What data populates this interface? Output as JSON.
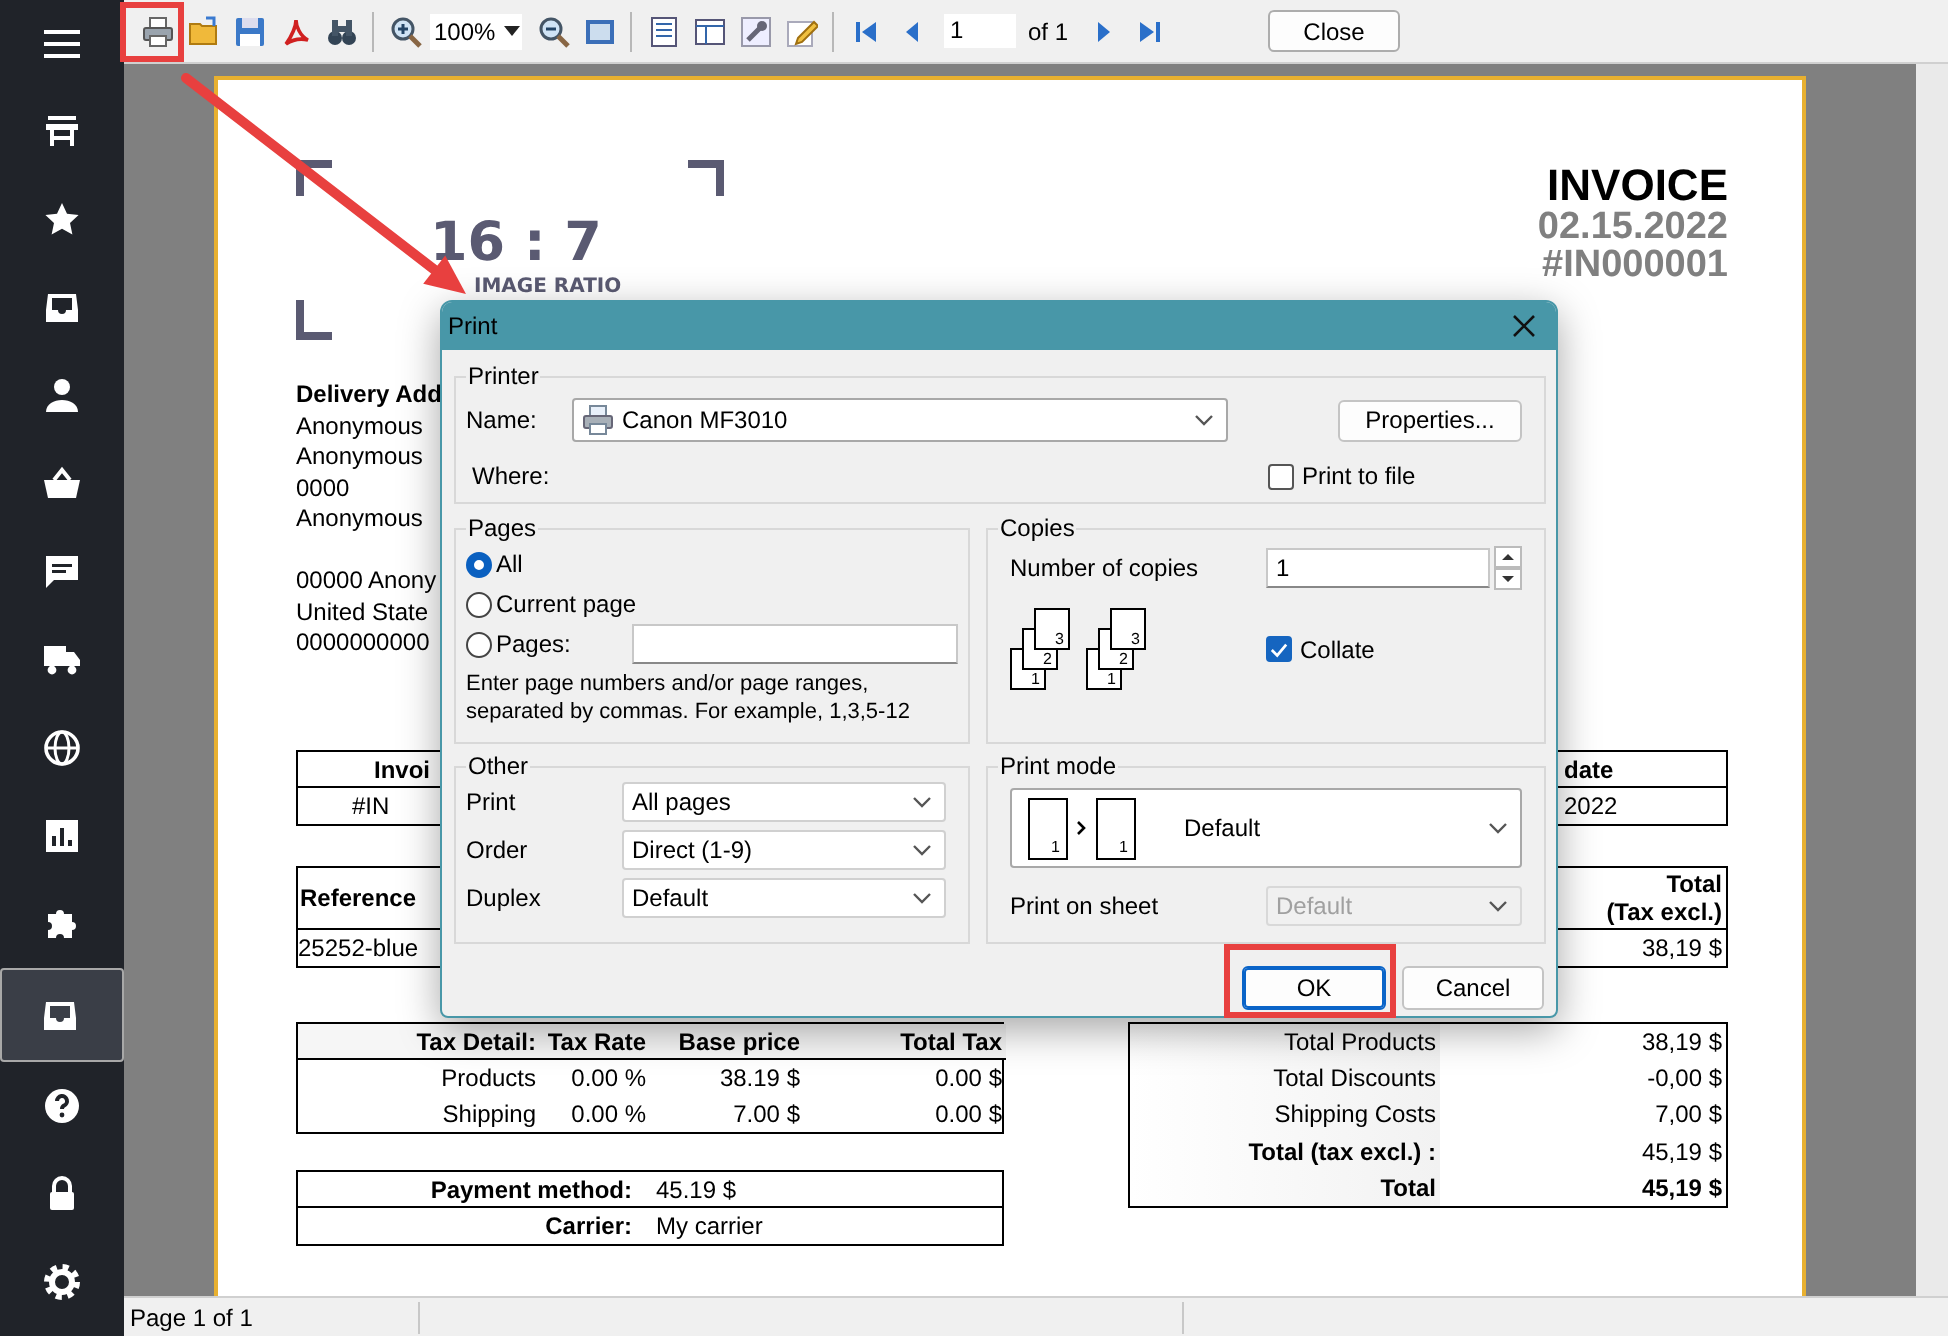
{
  "sidebar": {
    "items": [
      {
        "selected": false
      },
      {
        "selected": false
      },
      {
        "selected": false
      },
      {
        "selected": false
      },
      {
        "selected": false
      },
      {
        "selected": false
      },
      {
        "selected": false
      },
      {
        "selected": false
      },
      {
        "selected": false
      },
      {
        "selected": false
      },
      {
        "selected": true
      },
      {
        "selected": false
      },
      {
        "selected": false
      },
      {
        "selected": false
      }
    ]
  },
  "toolbar": {
    "zoom": "100%",
    "page": "1",
    "page_count": "of 1",
    "close": "Close"
  },
  "document": {
    "logo": {
      "ratio": "16 : 7",
      "caption": "IMAGE RATIO"
    },
    "title": "INVOICE",
    "date": "02.15.2022",
    "number": "#IN000001",
    "address_heading": "Delivery Add",
    "address_blocks": [
      [
        "Anonymous",
        "Anonymous",
        "0000",
        "Anonymous"
      ],
      [
        "00000 Anony",
        "United State",
        "0000000000"
      ]
    ],
    "invoice_table": {
      "columns": [
        "Invoi",
        "date"
      ],
      "row": [
        "#IN",
        "2022"
      ]
    },
    "products_table": {
      "columns": [
        "Reference",
        "Total\n(Tax excl.)"
      ],
      "row": [
        "25252-blue",
        "38,19 $"
      ]
    },
    "tax_table": {
      "columns": [
        "Tax Detail:",
        "Tax Rate",
        "Base price",
        "Total Tax"
      ],
      "rows": [
        [
          "Products",
          "0.00 %",
          "38.19 $",
          "0.00 $"
        ],
        [
          "Shipping",
          "0.00 %",
          "7.00 $",
          "0.00 $"
        ]
      ]
    },
    "payment": [
      {
        "label": "Payment method:",
        "value": "45.19 $"
      },
      {
        "label": "Carrier:",
        "value": "My carrier"
      }
    ],
    "totals": [
      {
        "label": "Total Products",
        "value": "38,19 $",
        "bold_label": false,
        "bold_value": false
      },
      {
        "label": "Total Discounts",
        "value": "-0,00 $",
        "bold_label": false,
        "bold_value": false
      },
      {
        "label": "Shipping Costs",
        "value": "7,00 $",
        "bold_label": false,
        "bold_value": false
      },
      {
        "label": "Total (tax excl.) :",
        "value": "45,19 $",
        "bold_label": true,
        "bold_value": false
      },
      {
        "label": "Total",
        "value": "45,19 $",
        "bold_label": true,
        "bold_value": true
      }
    ]
  },
  "dialog": {
    "title": "Print",
    "printer": {
      "legend": "Printer",
      "name_label": "Name:",
      "name": "Canon MF3010",
      "where_label": "Where:",
      "properties": "Properties...",
      "print_to_file": {
        "label": "Print to file",
        "checked": false
      }
    },
    "pages": {
      "legend": "Pages",
      "options": [
        {
          "label": "All",
          "selected": true
        },
        {
          "label": "Current page",
          "selected": false
        },
        {
          "label": "Pages:",
          "selected": false
        }
      ],
      "hint": "Enter page numbers and/or page ranges, separated by commas. For example, 1,3,5-12"
    },
    "copies": {
      "legend": "Copies",
      "label": "Number of copies",
      "value": "1",
      "collate_pages": [
        [
          "1",
          "2",
          "3"
        ],
        [
          "1",
          "2",
          "3"
        ]
      ],
      "collate": {
        "label": "Collate",
        "checked": true
      }
    },
    "other": {
      "legend": "Other",
      "fields": [
        {
          "label": "Print",
          "value": "All pages"
        },
        {
          "label": "Order",
          "value": "Direct (1-9)"
        },
        {
          "label": "Duplex",
          "value": "Default"
        }
      ]
    },
    "print_mode": {
      "legend": "Print mode",
      "pages": [
        "1",
        "1"
      ],
      "value": "Default",
      "sheet_label": "Print on sheet",
      "sheet_value": "Default",
      "sheet_disabled": true
    },
    "buttons": [
      {
        "label": "OK",
        "focused": true
      },
      {
        "label": "Cancel",
        "focused": false
      }
    ]
  },
  "status_bar": {
    "text": "Page 1 of 1"
  }
}
